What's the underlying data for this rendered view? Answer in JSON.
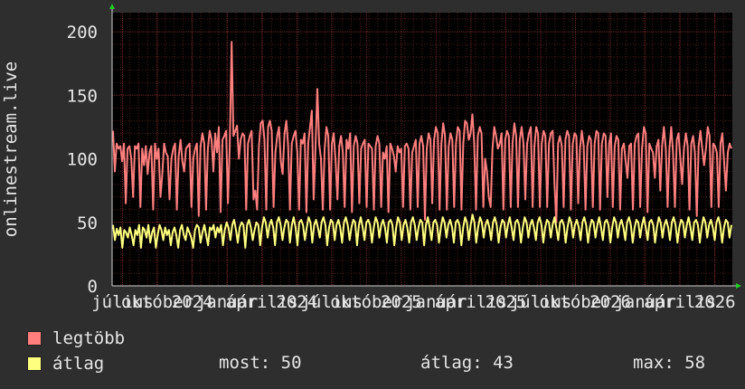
{
  "chart_data": {
    "type": "line",
    "ylabel": "onlinestream.live",
    "ylim": [
      0,
      215
    ],
    "yticks": [
      0,
      50,
      100,
      150,
      200
    ],
    "xticks": [
      "július",
      "október",
      "2024",
      "január",
      "április",
      "2024",
      "július",
      "október",
      "2025",
      "január",
      "április",
      "2025",
      "július",
      "október",
      "2026",
      "január",
      "április",
      "2026"
    ],
    "grid": true,
    "colors": {
      "legtobb": "#ff7f7f",
      "atlag": "#ffff7f"
    },
    "series": [
      {
        "name": "legtöbb",
        "values": [
          122,
          90,
          112,
          108,
          110,
          98,
          112,
          65,
          108,
          110,
          100,
          70,
          110,
          108,
          112,
          62,
          108,
          95,
          110,
          88,
          105,
          110,
          60,
          112,
          100,
          108,
          70,
          88,
          112,
          105,
          102,
          68,
          100,
          108,
          112,
          60,
          102,
          115,
          98,
          90,
          108,
          110,
          112,
          62,
          100,
          108,
          112,
          55,
          110,
          120,
          112,
          60,
          108,
          122,
          115,
          90,
          120,
          105,
          125,
          58,
          115,
          118,
          122,
          65,
          110,
          192,
          118,
          122,
          126,
          100,
          115,
          120,
          118,
          60,
          112,
          118,
          122,
          68,
          75,
          60,
          110,
          128,
          130,
          115,
          60,
          125,
          130,
          122,
          62,
          105,
          118,
          125,
          98,
          88,
          120,
          130,
          110,
          60,
          112,
          118,
          122,
          105,
          60,
          115,
          112,
          120,
          58,
          112,
          125,
          138,
          68,
          110,
          155,
          112,
          100,
          60,
          108,
          125,
          118,
          60,
          112,
          120,
          98,
          68,
          110,
          118,
          105,
          62,
          115,
          108,
          120,
          58,
          110,
          118,
          112,
          65,
          108,
          112,
          115,
          62,
          112,
          110,
          108,
          60,
          110,
          118,
          112,
          62,
          105,
          100,
          110,
          58,
          112,
          108,
          102,
          90,
          110,
          105,
          108,
          62,
          110,
          112,
          108,
          60,
          105,
          110,
          115,
          62,
          112,
          118,
          110,
          52,
          108,
          120,
          115,
          65,
          115,
          125,
          120,
          60,
          112,
          128,
          118,
          60,
          110,
          120,
          115,
          62,
          112,
          125,
          122,
          60,
          112,
          130,
          128,
          115,
          120,
          135,
          112,
          60,
          118,
          125,
          120,
          62,
          100,
          90,
          70,
          62,
          108,
          125,
          118,
          108,
          112,
          120,
          60,
          115,
          122,
          118,
          62,
          112,
          128,
          118,
          62,
          115,
          125,
          112,
          68,
          112,
          120,
          125,
          62,
          110,
          125,
          120,
          62,
          112,
          122,
          118,
          62,
          112,
          120,
          122,
          80,
          50,
          112,
          118,
          110,
          62,
          115,
          122,
          118,
          60,
          112,
          120,
          118,
          65,
          108,
          122,
          110,
          60,
          110,
          118,
          115,
          62,
          112,
          122,
          120,
          60,
          112,
          120,
          118,
          70,
          112,
          120,
          62,
          110,
          118,
          115,
          60,
          108,
          112,
          98,
          85,
          110,
          112,
          60,
          112,
          118,
          120,
          62,
          108,
          125,
          120,
          58,
          112,
          108,
          105,
          85,
          110,
          115,
          75,
          110,
          125,
          108,
          62,
          108,
          125,
          105,
          62,
          115,
          120,
          100,
          80,
          108,
          120,
          110,
          60,
          112,
          118,
          105,
          55,
          110,
          122,
          108,
          95,
          108,
          125,
          118,
          62,
          112,
          110,
          105,
          62,
          112,
          120,
          98,
          75,
          105,
          112,
          108
        ],
        "dashed": false
      },
      {
        "name": "átlag",
        "values": [
          48,
          36,
          45,
          40,
          46,
          30,
          44,
          42,
          38,
          46,
          40,
          32,
          44,
          40,
          48,
          30,
          46,
          44,
          38,
          48,
          34,
          42,
          46,
          30,
          40,
          48,
          44,
          36,
          46,
          40,
          44,
          32,
          42,
          46,
          40,
          30,
          44,
          48,
          40,
          36,
          46,
          42,
          38,
          30,
          44,
          48,
          46,
          34,
          42,
          48,
          40,
          32,
          46,
          44,
          48,
          38,
          46,
          42,
          48,
          32,
          44,
          50,
          46,
          36,
          48,
          52,
          44,
          34,
          46,
          50,
          48,
          30,
          48,
          52,
          46,
          36,
          44,
          50,
          48,
          32,
          46,
          54,
          50,
          38,
          48,
          52,
          46,
          32,
          50,
          54,
          48,
          36,
          46,
          52,
          50,
          34,
          48,
          54,
          46,
          32,
          50,
          52,
          48,
          36,
          46,
          54,
          50,
          34,
          48,
          52,
          46,
          38,
          50,
          54,
          48,
          32,
          46,
          52,
          50,
          36,
          48,
          52,
          46,
          34,
          50,
          54,
          48,
          36,
          46,
          52,
          50,
          32,
          48,
          54,
          46,
          36,
          50,
          52,
          48,
          34,
          46,
          54,
          50,
          38,
          48,
          52,
          46,
          34,
          50,
          52,
          48,
          32,
          46,
          54,
          50,
          36,
          48,
          52,
          46,
          34,
          50,
          54,
          48,
          36,
          46,
          52,
          50,
          32,
          48,
          54,
          46,
          36,
          50,
          52,
          48,
          34,
          46,
          54,
          50,
          38,
          48,
          52,
          46,
          34,
          50,
          52,
          48,
          32,
          46,
          54,
          50,
          36,
          48,
          56,
          50,
          34,
          46,
          54,
          50,
          38,
          48,
          52,
          46,
          36,
          50,
          54,
          48,
          34,
          46,
          52,
          50,
          38,
          48,
          54,
          46,
          36,
          50,
          52,
          48,
          34,
          46,
          54,
          50,
          38,
          48,
          52,
          46,
          36,
          50,
          54,
          48,
          34,
          46,
          52,
          50,
          38,
          48,
          54,
          46,
          36,
          50,
          52,
          48,
          34,
          46,
          54,
          50,
          38,
          48,
          52,
          46,
          36,
          50,
          54,
          48,
          34,
          46,
          52,
          50,
          38,
          48,
          54,
          46,
          36,
          50,
          52,
          48,
          34,
          46,
          54,
          50,
          38,
          48,
          52,
          46,
          36,
          50,
          54,
          48,
          34,
          46,
          52,
          50,
          38,
          48,
          54,
          46,
          36,
          50,
          52,
          48,
          34,
          46,
          54,
          50,
          38,
          48,
          52,
          46,
          36,
          50,
          54,
          48,
          34,
          46,
          52,
          50,
          38,
          48,
          54,
          46,
          36,
          50,
          52,
          48,
          34,
          46,
          54,
          50,
          38,
          48,
          52,
          46,
          36,
          50,
          54,
          48,
          34,
          46,
          52,
          50,
          38,
          48
        ],
        "dashed": false
      }
    ]
  },
  "legend": {
    "items": [
      {
        "label": "legtöbb",
        "color": "#ff7f7f"
      },
      {
        "label": "átlag",
        "color": "#ffff7f"
      }
    ],
    "stats": {
      "most_label": "most:",
      "most_value": "50",
      "atlag_label": "átlag:",
      "atlag_value": "43",
      "max_label": "max:",
      "max_value": "58"
    }
  }
}
